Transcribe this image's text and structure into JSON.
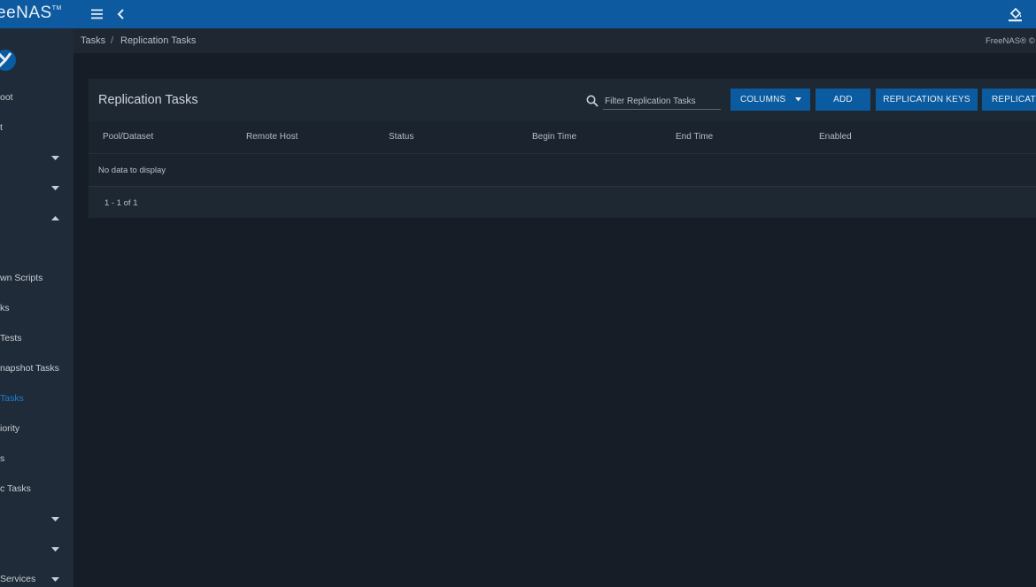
{
  "topbar": {
    "brand": "eeNAS",
    "brand_mark": "TM",
    "icons": [
      "menu-icon",
      "chevron-left-icon",
      "paint-bucket-icon"
    ],
    "color": "#0d5aa0"
  },
  "breadcrumb": {
    "items": [
      "Tasks",
      "Replication Tasks"
    ],
    "separator": "/",
    "copyright": "FreeNAS® ©"
  },
  "sidebar": {
    "items": [
      {
        "label": "oot"
      },
      {
        "label": "t"
      },
      {
        "label": ""
      },
      {
        "label": ""
      },
      {
        "label": ""
      },
      {
        "label": "wn Scripts"
      },
      {
        "label": "ks"
      },
      {
        "label": "Tests"
      },
      {
        "label": "napshot Tasks"
      },
      {
        "label": "Tasks",
        "active": true
      },
      {
        "label": "iority"
      },
      {
        "label": "s"
      },
      {
        "label": "c Tasks"
      },
      {
        "label": ""
      },
      {
        "label": ""
      },
      {
        "label": "Services"
      }
    ],
    "active_color": "#1f7ed0"
  },
  "card": {
    "title": "Replication Tasks",
    "filter_placeholder": "Filter Replication Tasks",
    "buttons": {
      "columns": "COLUMNS",
      "add": "ADD",
      "replication_keys": "REPLICATION KEYS",
      "replication": "REPLICATI"
    },
    "columns": [
      "Pool/Dataset",
      "Remote Host",
      "Status",
      "Begin Time",
      "End Time",
      "Enabled"
    ],
    "empty_message": "No data to display",
    "pagination": "1 - 1 of 1"
  },
  "colors": {
    "background": "#161d26",
    "card": "#1e2833",
    "button": "#0a5ba0"
  }
}
